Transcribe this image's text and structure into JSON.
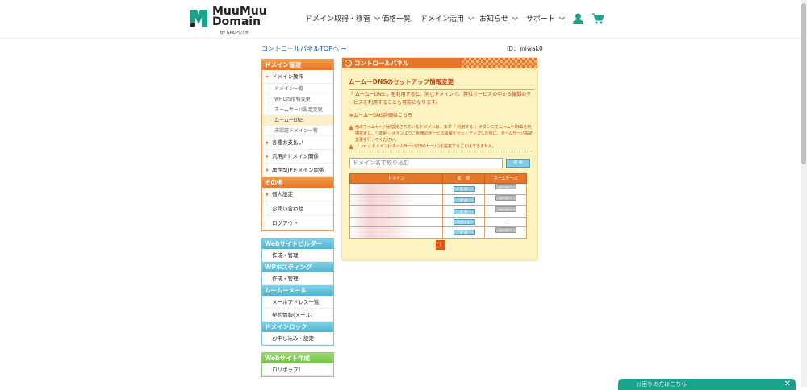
{
  "header": {
    "logo_line1": "MuuMuu",
    "logo_line2": "Domain",
    "logo_sub": "by GMOペパボ",
    "nav": [
      "ドメイン取得・移管",
      "価格一覧",
      "ドメイン活用",
      "お知らせ",
      "サポート"
    ]
  },
  "top_link": "コントロールパネルTOPへ →",
  "user_id": "ID：miwak0",
  "sidebar": {
    "domain_head": "ドメイン管理",
    "domain_ops": "ドメイン操作",
    "subs": [
      "ドメイン一覧",
      "WHOIS情報変更",
      "ネームサーバ設定変更",
      "ムームーDNS",
      "未認証ドメイン一覧"
    ],
    "items": [
      "各種お支払い",
      "汎用JPドメイン関係",
      "属性型JPドメイン関係"
    ],
    "other_head": "その他",
    "other_items": [
      "個人設定",
      "お問い合わせ",
      "ログアウト"
    ],
    "webbuilder_head": "Webサイトビルダー",
    "webbuilder_item": "作成・管理",
    "wp_head": "WPホスティング",
    "wp_item": "作成・管理",
    "mail_head": "ムームーメール",
    "mail_items": [
      "メールアドレス一覧",
      "契約情報(メール)"
    ],
    "lock_head": "ドメインロック",
    "lock_item": "お申し込み・設定",
    "site_head": "Webサイト作成",
    "site_item": "ロリポップ！"
  },
  "panel": {
    "title": "コントロールパネル",
    "section_title": "ムームーDNSのセットアップ情報変更",
    "desc": "『 ムームーDNS 』を利用すると、同じドメインで、弊社サービスの中から複数のサービスを利用することも可能になります。",
    "detail_link": "≫ムームーDNS詳細はこちら",
    "warn1": "他のネームサーバが設定されているドメインは、まず『 利用する 』ボタンにてムームーDNSを利用設定し、『 変更 』ボタンよりご利用のサービス情報をセットアップした後に、ネームサーバ設定変更を行ってください。",
    "warn2": "『 .co 』ドメインはネームサーバ(DNSサーバ)を設定することはできません。",
    "filter_placeholder": "ドメイン名で絞り込む",
    "filter_btn": "検 索",
    "table_headers": [
      "ドメイン",
      "処　理",
      "ネームサーバ"
    ],
    "rows": [
      {
        "action": "変 更",
        "ns": "ムームーDNS"
      },
      {
        "action": "変 更",
        "ns": "ムームーDNS"
      },
      {
        "action": "変 更",
        "ns": "ムームーDNS"
      },
      {
        "action": "利用する",
        "ns": "－"
      },
      {
        "action": "変 更",
        "ns": "ムームーDNS"
      }
    ],
    "page": "1"
  },
  "chat": {
    "label": "お困りの方はこちら",
    "close": "✕"
  },
  "colors": {
    "accent": "#e8762a",
    "panel_bg": "#fdf3c0",
    "chat": "#1aa38a"
  }
}
